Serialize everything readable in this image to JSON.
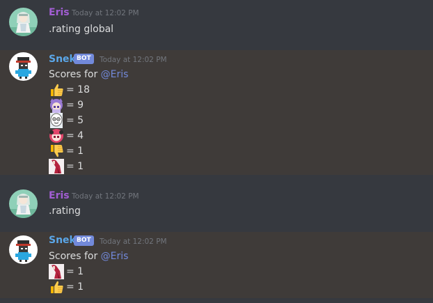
{
  "messages": [
    {
      "author": "Eris",
      "author_color": "#a25ed3",
      "timestamp": "Today at 12:02 PM",
      "content": ".rating global"
    },
    {
      "author": "Snek",
      "author_color": "#5ba7e9",
      "bot_tag": "BOT",
      "timestamp": "Today at 12:02 PM",
      "scores_prefix": "Scores for ",
      "mention": "@Eris",
      "ratings": [
        {
          "emoji": "thumbs-up-emoji",
          "text": "= 18"
        },
        {
          "emoji": "purple-hair-girl-emoji",
          "text": "= 9"
        },
        {
          "emoji": "white-blob-face-emoji",
          "text": "= 5"
        },
        {
          "emoji": "pink-hair-girl-emoji",
          "text": "= 4"
        },
        {
          "emoji": "thumbs-down-emoji",
          "text": "= 1"
        },
        {
          "emoji": "red-dress-character-emoji",
          "text": "= 1"
        }
      ]
    },
    {
      "author": "Eris",
      "author_color": "#a25ed3",
      "timestamp": "Today at 12:02 PM",
      "content": ".rating"
    },
    {
      "author": "Snek",
      "author_color": "#5ba7e9",
      "bot_tag": "BOT",
      "timestamp": "Today at 12:02 PM",
      "scores_prefix": "Scores for ",
      "mention": "@Eris",
      "ratings": [
        {
          "emoji": "red-dress-character-emoji",
          "text": "= 1"
        },
        {
          "emoji": "thumbs-up-emoji",
          "text": "= 1"
        }
      ]
    }
  ],
  "colors": {
    "background": "#36393f",
    "bot_message_background": "#3f3b39",
    "text": "#dcddde",
    "timestamp": "#72767d",
    "mention": "#7289da",
    "bot_tag": "#7289da"
  }
}
